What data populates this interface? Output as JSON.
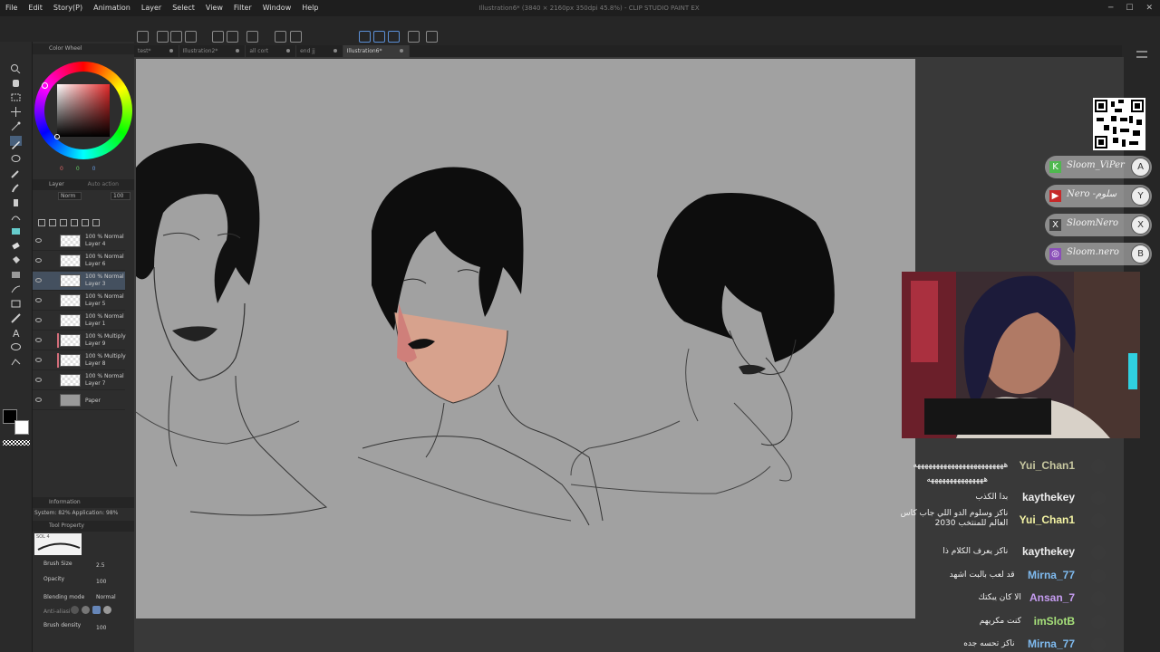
{
  "menu": [
    "File",
    "Edit",
    "Story(P)",
    "Animation",
    "Layer",
    "Select",
    "View",
    "Filter",
    "Window",
    "Help"
  ],
  "window_title": "Illustration6* (3840 × 2160px 350dpi 45.8%) - CLIP STUDIO PAINT EX",
  "tabs": [
    {
      "label": "test*",
      "active": false
    },
    {
      "label": "Illustration2*",
      "active": false
    },
    {
      "label": "all cort",
      "active": false
    },
    {
      "label": "end jj",
      "active": false
    },
    {
      "label": "Illustration6*",
      "active": true
    }
  ],
  "color_panel": {
    "title": "Color Wheel",
    "values": [
      "0",
      "0",
      "0"
    ]
  },
  "layer_panel": {
    "tabs": [
      "Layer",
      "Auto action"
    ],
    "blend": "Norm",
    "opacity": "100",
    "layers": [
      {
        "mode": "100 % Normal",
        "name": "Layer 4",
        "multiply": false,
        "selected": false
      },
      {
        "mode": "100 % Normal",
        "name": "Layer 6",
        "multiply": false,
        "selected": false
      },
      {
        "mode": "100 % Normal",
        "name": "Layer 3",
        "multiply": false,
        "selected": true
      },
      {
        "mode": "100 % Normal",
        "name": "Layer 5",
        "multiply": false,
        "selected": false
      },
      {
        "mode": "100 % Normal",
        "name": "Layer 1",
        "multiply": false,
        "selected": false
      },
      {
        "mode": "100 % Multiply",
        "name": "Layer 9",
        "multiply": true,
        "selected": false
      },
      {
        "mode": "100 % Multiply",
        "name": "Layer 8",
        "multiply": true,
        "selected": false
      },
      {
        "mode": "100 % Normal",
        "name": "Layer 7",
        "multiply": false,
        "selected": false
      },
      {
        "mode": "",
        "name": "Paper",
        "multiply": false,
        "selected": false
      }
    ]
  },
  "information": {
    "title": "Information",
    "system": "System: 82%  Application: 98%"
  },
  "tool_property": {
    "title": "Tool Property",
    "brush_name": "SOL 4",
    "rows": [
      {
        "label": "Brush Size",
        "value": "2.5"
      },
      {
        "label": "Opacity",
        "value": "100"
      },
      {
        "label": "Blending mode",
        "value": "Normal"
      },
      {
        "label": "Anti-aliasi",
        "value": ""
      },
      {
        "label": "Brush density",
        "value": "100"
      }
    ]
  },
  "socials": [
    {
      "icon": "K",
      "handle": "Sloom_ViPer",
      "badge": "A",
      "color": "#4fb84f"
    },
    {
      "icon": "▶",
      "handle": "Nero -سلوم",
      "badge": "Y",
      "color": "#c62828"
    },
    {
      "icon": "X",
      "handle": "SloomNero",
      "badge": "X",
      "color": "#444444"
    },
    {
      "icon": "◎",
      "handle": "Sloom.nero",
      "badge": "B",
      "color": "#8a4fb8"
    }
  ],
  "chat": [
    {
      "name": "Yui_Chan1",
      "message": "ههههههههههههههههههههههههه",
      "color": "#c7c7a0"
    },
    {
      "name": "",
      "message": "هههههههههههههههه",
      "color": "#ffffff"
    },
    {
      "name": "kaythekey",
      "message": "بدا الكذب",
      "color": "#f0f0f0"
    },
    {
      "name": "Yui_Chan1",
      "message": "ناكز وسلوم الدو اللي جاب كاس العالم للمنتخب 2030",
      "color": "#f4f4a4"
    },
    {
      "name": "kaythekey",
      "message": "ناكز يعرف الكلام ذا",
      "color": "#f0f0f0"
    },
    {
      "name": "Mirna_77",
      "message": "قد لعب بالبت اشهد",
      "color": "#7fbbf0"
    },
    {
      "name": "Ansan_7",
      "message": "الا كان يبكتك",
      "color": "#c59cf0"
    },
    {
      "name": "imSlotB",
      "message": "كنت مكريهم",
      "color": "#a6e07a"
    },
    {
      "name": "Mirna_77",
      "message": "ناكز تحسه جده",
      "color": "#7fbbf0"
    }
  ]
}
